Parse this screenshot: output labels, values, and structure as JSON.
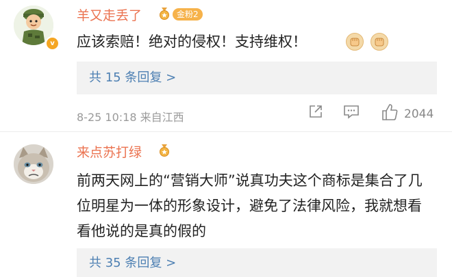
{
  "comments": [
    {
      "username": "羊又走丢了",
      "fan_badge": "金粉2",
      "text": "应该索赔！绝对的侵权！支持维权！",
      "replies": "共 15 条回复 >",
      "timestamp": "8-25 10:18",
      "location": "来自江西",
      "likes": "2044"
    },
    {
      "username": "来点苏打绿",
      "text": "前两天网上的“营销大师”说真功夫这个商标是集合了几位明星为一体的形象设计，避免了法律风险，我就想看看他说的是真的假的",
      "replies": "共 35 条回复 >"
    }
  ]
}
